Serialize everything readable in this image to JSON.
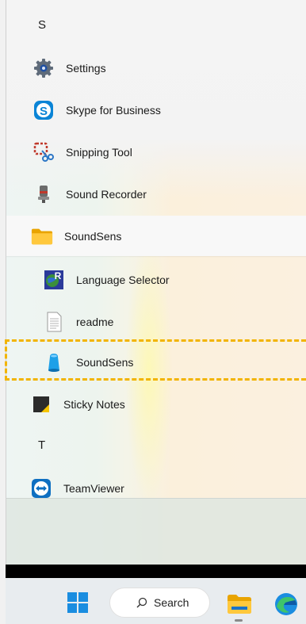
{
  "start_menu": {
    "section_s": "S",
    "section_t": "T",
    "apps": [
      {
        "label": "Settings",
        "icon": "gear-icon"
      },
      {
        "label": "Skype for Business",
        "icon": "skype-icon"
      },
      {
        "label": "Snipping Tool",
        "icon": "snipping-tool-icon"
      },
      {
        "label": "Sound Recorder",
        "icon": "microphone-icon"
      },
      {
        "label": "SoundSens",
        "icon": "folder-icon"
      }
    ],
    "folder_items": [
      {
        "label": "Language Selector",
        "icon": "language-selector-icon"
      },
      {
        "label": "readme",
        "icon": "document-icon"
      },
      {
        "label": "SoundSens",
        "icon": "blue-thimble-icon"
      }
    ],
    "apps_after": [
      {
        "label": "Sticky Notes",
        "icon": "sticky-notes-icon"
      }
    ],
    "apps_t": [
      {
        "label": "TeamViewer",
        "icon": "teamviewer-icon"
      }
    ]
  },
  "taskbar": {
    "search_label": "Search",
    "accent_color": "#0a84d6",
    "highlight_color": "#f2b400"
  }
}
